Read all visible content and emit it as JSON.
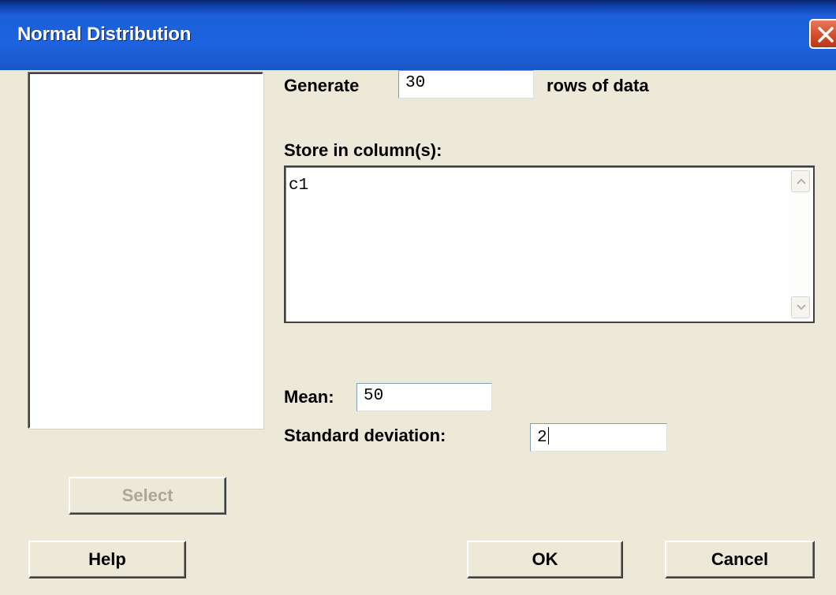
{
  "window": {
    "title": "Normal Distribution"
  },
  "generate": {
    "label_before": "Generate",
    "value": "30",
    "label_after": "rows of data"
  },
  "store": {
    "label": "Store in column(s):",
    "value": "c1"
  },
  "mean": {
    "label": "Mean:",
    "value": "50"
  },
  "std_dev": {
    "label": "Standard deviation:",
    "value": "2"
  },
  "buttons": {
    "select": "Select",
    "help": "Help",
    "ok": "OK",
    "cancel": "Cancel"
  },
  "icons": {
    "close": "close-icon",
    "scroll_up": "chevron-up-icon",
    "scroll_down": "chevron-down-icon"
  },
  "colors": {
    "titlebar": "#1d63df",
    "close": "#d24d2c",
    "dialog_bg": "#ece9d8"
  }
}
